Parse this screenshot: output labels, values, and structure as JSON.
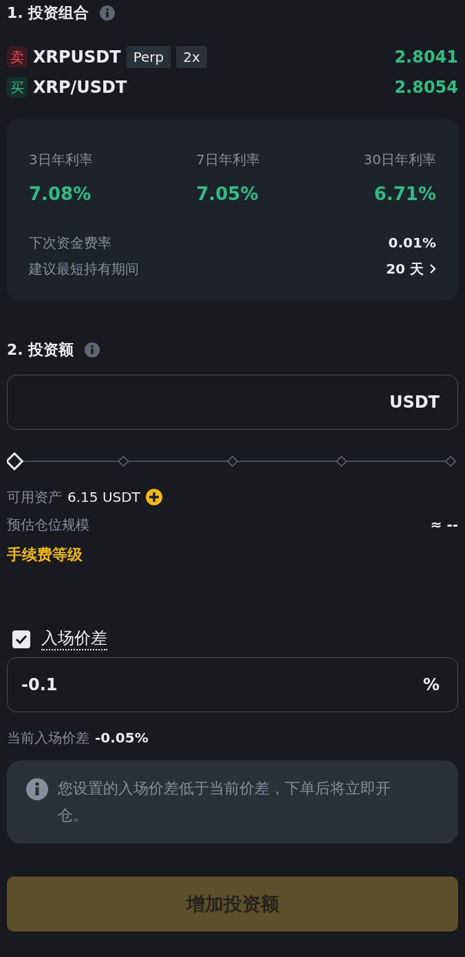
{
  "portfolio": {
    "title": "1. 投资组合",
    "pairs": [
      {
        "side": "卖",
        "kind": "sell",
        "symbol": "XRPUSDT",
        "tags": [
          "Perp",
          "2x"
        ],
        "price": "2.8041"
      },
      {
        "side": "买",
        "kind": "buy",
        "symbol": "XRP/USDT",
        "price": "2.8054"
      }
    ],
    "rates": [
      {
        "label": "3日年利率",
        "value": "7.08%"
      },
      {
        "label": "7日年利率",
        "value": "7.05%"
      },
      {
        "label": "30日年利率",
        "value": "6.71%"
      }
    ],
    "details": [
      {
        "label": "下次资金费率",
        "value": "0.01%",
        "kind": "plain"
      },
      {
        "label": "建议最短持有期间",
        "value": "20 天",
        "kind": "link"
      }
    ]
  },
  "investment": {
    "title": "2. 投资额",
    "unit": "USDT",
    "slider": {
      "level": 0
    },
    "available_label": "可用资产",
    "available_value": "6.15 USDT",
    "position_label": "预估仓位规模",
    "position_value": "≈ --",
    "fee_link": "手续费等级"
  },
  "spread": {
    "checked": true,
    "label": "入场价差",
    "value": "-0.1",
    "unit": "%",
    "current_label": "当前入场价差",
    "current_value": "-0.05%",
    "notice": "您设置的入场价差低于当前价差，下单后将立即开仓。"
  },
  "submit": {
    "label": "增加投资额",
    "disabled": true
  }
}
